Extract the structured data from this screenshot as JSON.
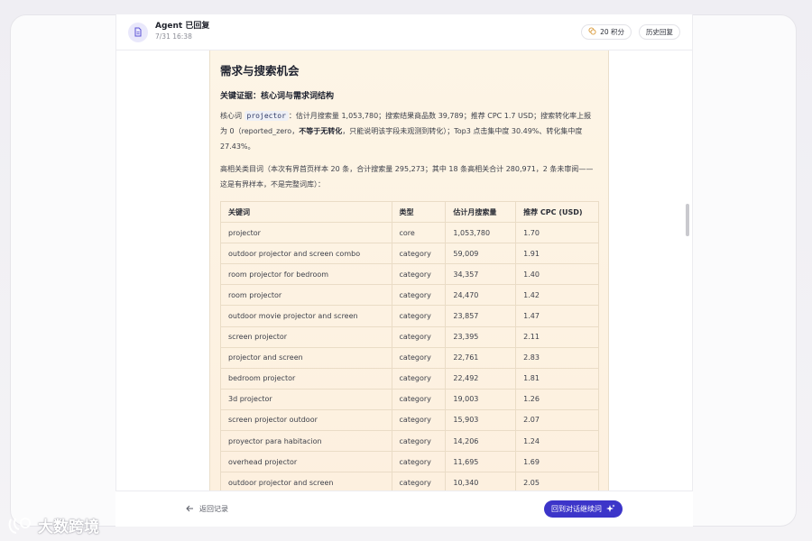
{
  "header": {
    "title": "Agent 已回复",
    "time": "7/31 16:38",
    "points_label": "20 积分",
    "history_label": "历史回复"
  },
  "content": {
    "section_title": "需求与搜索机会",
    "sub_title": "关键证据：核心词与需求词结构",
    "para1": {
      "prefix": "核心词",
      "keyword": "projector",
      "part1": "：估计月搜索量 1,053,780；搜索结果商品数 39,789；推荐 CPC 1.7 USD；搜索转化率上报为 0（reported_zero，",
      "bold": "不等于无转化",
      "part2": "，只能说明该字段未观测到转化）；Top3 点击集中度 30.49%、转化集中度 27.43%。"
    },
    "para2": "高相关类目词（本次有界首页样本 20 条，合计搜索量 295,273；其中 18 条高相关合计 280,971，2 条未审阅——这是有界样本，不是完整词库）：",
    "table": {
      "headers": [
        "关键词",
        "类型",
        "估计月搜索量",
        "推荐 CPC (USD)"
      ],
      "rows": [
        [
          "projector",
          "core",
          "1,053,780",
          "1.70"
        ],
        [
          "outdoor projector and screen combo",
          "category",
          "59,009",
          "1.91"
        ],
        [
          "room projector for bedroom",
          "category",
          "34,357",
          "1.40"
        ],
        [
          "room projector",
          "category",
          "24,470",
          "1.42"
        ],
        [
          "outdoor movie projector and screen",
          "category",
          "23,857",
          "1.47"
        ],
        [
          "screen projector",
          "category",
          "23,395",
          "2.11"
        ],
        [
          "projector and screen",
          "category",
          "22,761",
          "2.83"
        ],
        [
          "bedroom projector",
          "category",
          "22,492",
          "1.81"
        ],
        [
          "3d projector",
          "category",
          "19,003",
          "1.26"
        ],
        [
          "screen projector outdoor",
          "category",
          "15,903",
          "2.07"
        ],
        [
          "proyector para habitacion",
          "category",
          "14,206",
          "1.24"
        ],
        [
          "overhead projector",
          "category",
          "11,695",
          "1.69"
        ],
        [
          "outdoor projector and screen",
          "category",
          "10,340",
          "2.05"
        ]
      ]
    }
  },
  "footer": {
    "back_label": "返回记录",
    "continue_label": "回到对话继续问"
  },
  "watermark": "大数跨境",
  "colors": {
    "accent": "#3c35c9",
    "content_bg": "#fdf3e4",
    "table_border": "#eadcc6"
  },
  "icons": {
    "header": "document-icon",
    "points": "coin-icon",
    "back": "arrow-left-icon",
    "continue": "sparkle-icon"
  }
}
